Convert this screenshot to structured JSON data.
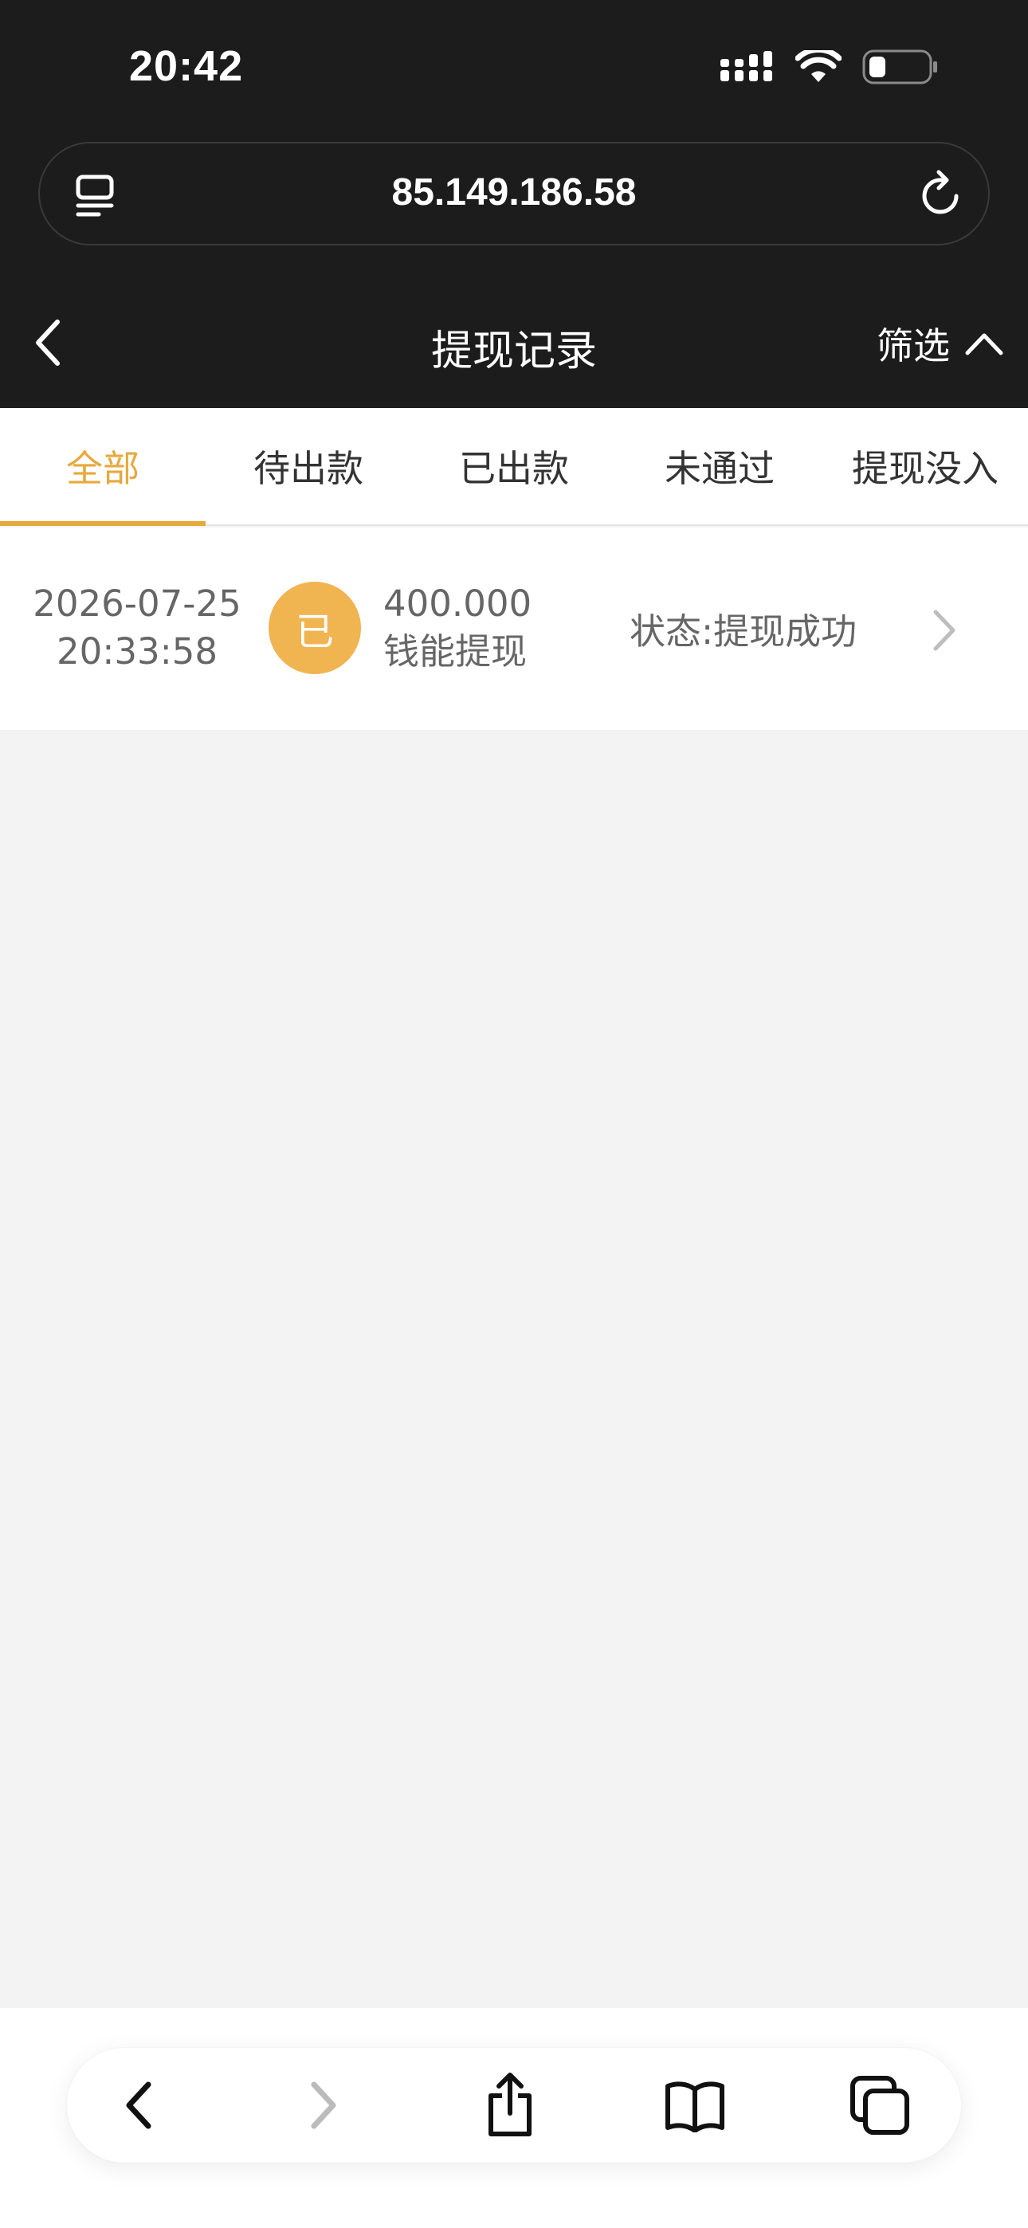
{
  "status_bar": {
    "time": "20:42"
  },
  "browser": {
    "url": "85.149.186.58"
  },
  "header": {
    "title": "提现记录",
    "filter_label": "筛选"
  },
  "tabs": [
    {
      "label": "全部",
      "active": true
    },
    {
      "label": "待出款",
      "active": false
    },
    {
      "label": "已出款",
      "active": false
    },
    {
      "label": "未通过",
      "active": false
    },
    {
      "label": "提现没入",
      "active": false
    }
  ],
  "records": [
    {
      "date": "2026-07-25",
      "time": "20:33:58",
      "badge": "已",
      "amount": "400.000",
      "type": "钱能提现",
      "status_label": "状态:",
      "status_value": "提现成功"
    }
  ],
  "colors": {
    "accent": "#e7a93d",
    "badge": "#f0b451",
    "header_bg": "#1c1c1c",
    "page_bg": "#f3f3f3"
  },
  "icons": {
    "url_left": "reader-mode-icon",
    "url_right": "reload-icon",
    "back": "chevron-left-icon",
    "filter": "chevron-up-icon",
    "row_arrow": "chevron-right-icon",
    "toolbar": [
      "back-arrow-icon",
      "forward-arrow-icon",
      "share-icon",
      "bookmarks-icon",
      "tabs-icon"
    ]
  }
}
